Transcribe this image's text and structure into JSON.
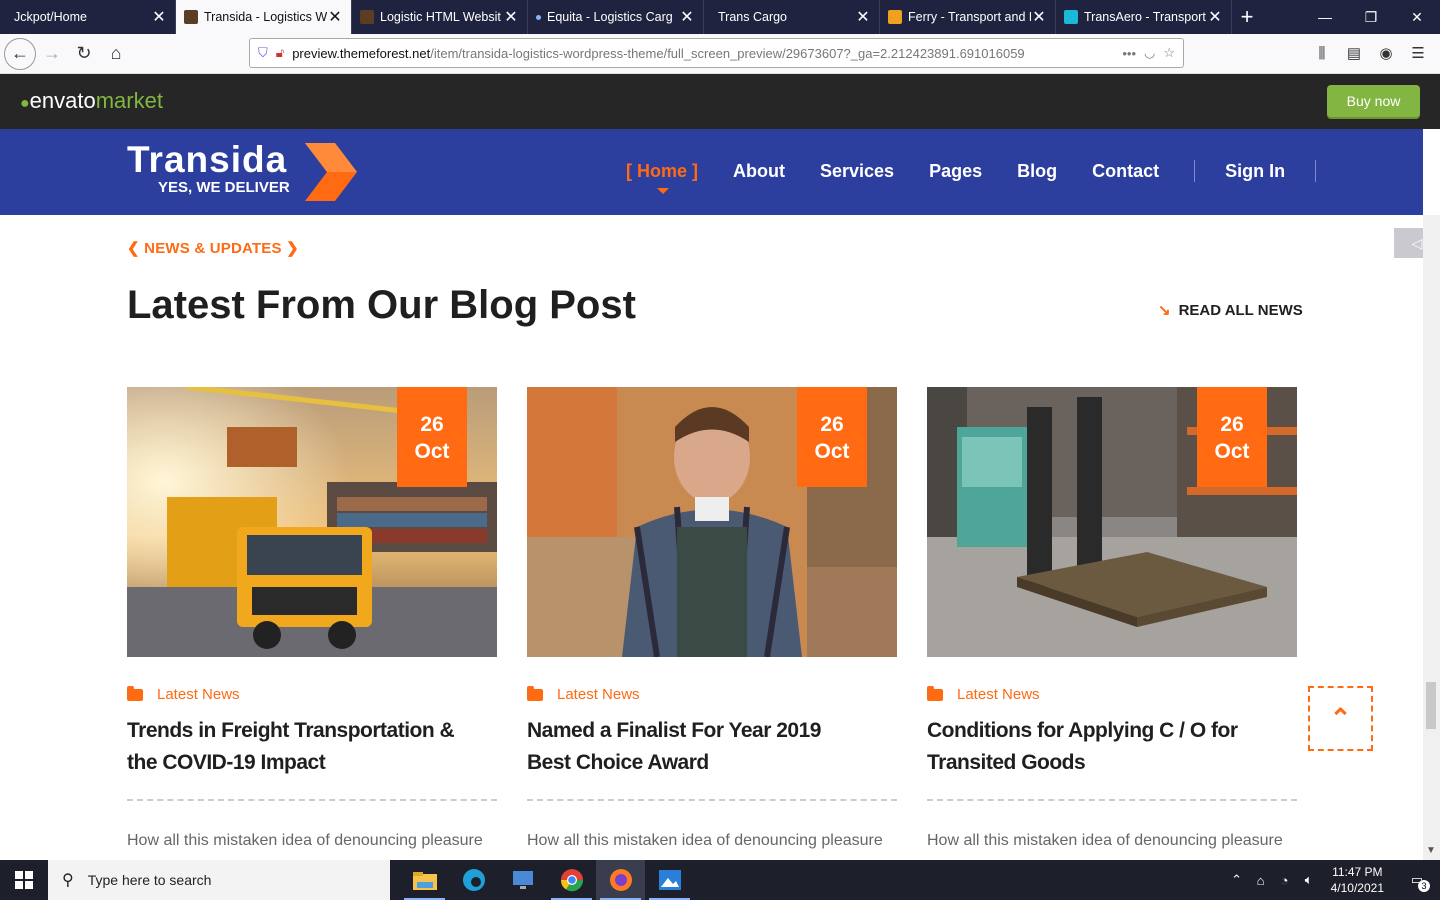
{
  "browser": {
    "tabs": [
      {
        "title": "Jckpot/Home",
        "active": false
      },
      {
        "title": "Transida - Logistics W",
        "active": true
      },
      {
        "title": "Logistic HTML Websit",
        "active": false
      },
      {
        "title": "Equita - Logistics Carg",
        "active": false
      },
      {
        "title": "Trans Cargo",
        "active": false
      },
      {
        "title": "Ferry - Transport and L",
        "active": false
      },
      {
        "title": "TransAero - Transport",
        "active": false
      }
    ],
    "url_domain": "preview.themeforest.net",
    "url_path": "/item/transida-logistics-wordpress-theme/full_screen_preview/29673607?_ga=2.212423891.691016059"
  },
  "envato": {
    "logo_word": "envato",
    "logo_market": "market",
    "buy_label": "Buy now"
  },
  "site": {
    "brand_title": "Transida",
    "brand_tagline": "YES, WE DELIVER",
    "menu": {
      "home": "[ Home ]",
      "about": "About",
      "services": "Services",
      "pages": "Pages",
      "blog": "Blog",
      "contact": "Contact",
      "signin": "Sign In"
    },
    "accent": "#ff6a13",
    "header_bg": "#2d3f9e"
  },
  "blog": {
    "eyebrow": "NEWS & UPDATES",
    "heading": "Latest From Our Blog Post",
    "read_all": "READ ALL NEWS",
    "posts": [
      {
        "day": "26",
        "month": "Oct",
        "category": "Latest News",
        "title": "Trends in Freight Transportation & the COVID-19 Impact",
        "excerpt": "How all this mistaken idea of denouncing pleasure and praising pain was"
      },
      {
        "day": "26",
        "month": "Oct",
        "category": "Latest News",
        "title": "Named a Finalist For Year 2019 Best Choice Award",
        "excerpt": "How all this mistaken idea of denouncing pleasure and praising pain was"
      },
      {
        "day": "26",
        "month": "Oct",
        "category": "Latest News",
        "title": "Conditions for Applying C / O for Transited Goods",
        "excerpt": "How all this mistaken idea of denouncing pleasure and praising pain was"
      }
    ]
  },
  "taskbar": {
    "search_placeholder": "Type here to search",
    "time": "11:47 PM",
    "date": "4/10/2021",
    "notifications": "3"
  }
}
